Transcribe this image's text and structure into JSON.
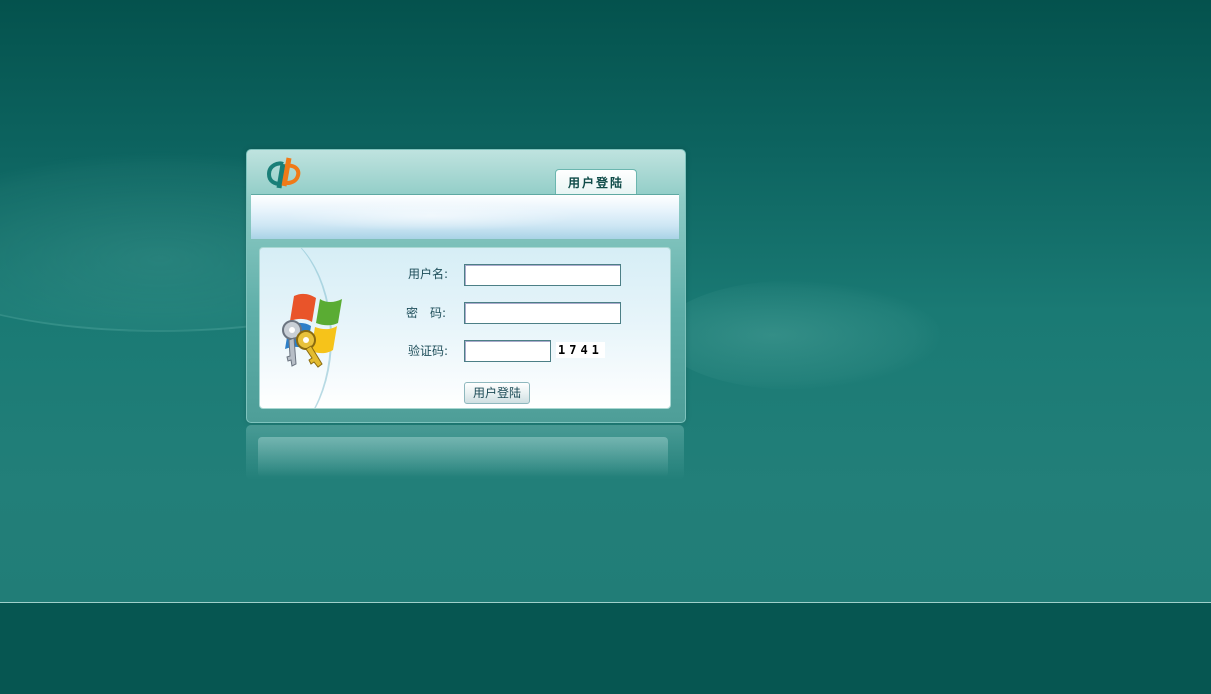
{
  "login": {
    "tab_label": "用户登陆",
    "username_label": "用户名:",
    "username_value": "",
    "password_label": "密　码:",
    "password_value": "",
    "captcha_label": "验证码:",
    "captcha_value": "",
    "captcha_code": "1741",
    "submit_label": "用户登陆"
  },
  "icons": {
    "brand_logo": "brand-logo-icon",
    "windows_keys": "windows-keys-icon"
  },
  "colors": {
    "background": "#1a7a74",
    "background_top": "#04524d",
    "footer": "#065651",
    "logo_teal": "#1a7f78",
    "logo_orange": "#f07a18",
    "label_text": "#1e4e5a"
  }
}
